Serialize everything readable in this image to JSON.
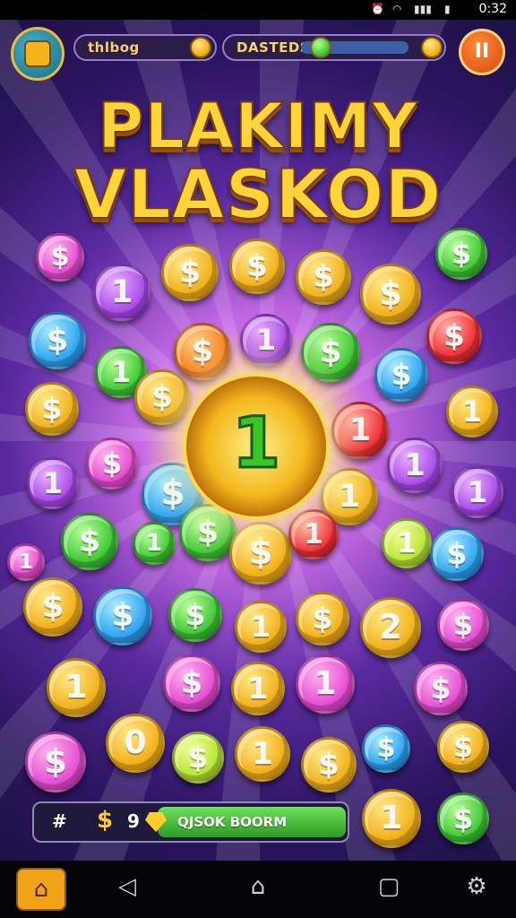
{
  "status_bar": {
    "time": "0:32"
  },
  "top_bar": {
    "left_label": "thlbog",
    "right_label": "DASTEDS",
    "pause_label": "II"
  },
  "title": {
    "line1": "PLAKIMY",
    "line2": "VLASKOD"
  },
  "center_coin": {
    "value": "1"
  },
  "bottom_bar": {
    "hash": "#",
    "currency_symbol": "$",
    "amount": "9",
    "button_label": "QJSOK BOORM"
  },
  "coin_glyphs": [
    "$",
    "1",
    "2"
  ],
  "colors": {
    "gold": "#f2b21e",
    "pink": "#e651d2",
    "purple": "#a94ee8",
    "blue": "#33a6f0",
    "green": "#45c93a",
    "red": "#f0343a",
    "orange": "#f5801e",
    "accent_button": "#2e9b23"
  },
  "coins": [
    {
      "color": "pink",
      "glyph": "$"
    },
    {
      "color": "purple",
      "glyph": "1"
    },
    {
      "color": "gold",
      "glyph": "$"
    },
    {
      "color": "gold",
      "glyph": "$"
    },
    {
      "color": "gold",
      "glyph": "$"
    },
    {
      "color": "gold",
      "glyph": "$"
    },
    {
      "color": "green",
      "glyph": "$"
    },
    {
      "color": "blue",
      "glyph": "$"
    },
    {
      "color": "orange",
      "glyph": "$"
    },
    {
      "color": "purple",
      "glyph": "1"
    },
    {
      "color": "green",
      "glyph": "$"
    },
    {
      "color": "blue",
      "glyph": "$"
    },
    {
      "color": "red",
      "glyph": "$"
    },
    {
      "color": "green",
      "glyph": "1"
    },
    {
      "color": "gold",
      "glyph": "$"
    },
    {
      "color": "gold",
      "glyph": "$"
    },
    {
      "color": "red",
      "glyph": "1"
    },
    {
      "color": "gold",
      "glyph": "1"
    },
    {
      "color": "purple",
      "glyph": "1"
    },
    {
      "color": "pink",
      "glyph": "$"
    },
    {
      "color": "purple",
      "glyph": "1"
    },
    {
      "color": "purple",
      "glyph": "1"
    },
    {
      "color": "blue",
      "glyph": "$"
    },
    {
      "color": "gold",
      "glyph": "1"
    },
    {
      "color": "green",
      "glyph": "$"
    },
    {
      "color": "gold",
      "glyph": "$"
    },
    {
      "color": "green",
      "glyph": "1"
    },
    {
      "color": "red",
      "glyph": "1"
    },
    {
      "color": "green",
      "glyph": "$"
    },
    {
      "color": "pink",
      "glyph": "1"
    },
    {
      "color": "lime",
      "glyph": "1"
    },
    {
      "color": "blue",
      "glyph": "$"
    },
    {
      "color": "gold",
      "glyph": "$"
    },
    {
      "color": "blue",
      "glyph": "$"
    },
    {
      "color": "green",
      "glyph": "$"
    },
    {
      "color": "gold",
      "glyph": "1"
    },
    {
      "color": "gold",
      "glyph": "$"
    },
    {
      "color": "gold",
      "glyph": "2"
    },
    {
      "color": "pink",
      "glyph": "$"
    },
    {
      "color": "gold",
      "glyph": "1"
    },
    {
      "color": "pink",
      "glyph": "$"
    },
    {
      "color": "gold",
      "glyph": "1"
    },
    {
      "color": "pink",
      "glyph": "1"
    },
    {
      "color": "pink",
      "glyph": "$"
    },
    {
      "color": "pink",
      "glyph": "$"
    },
    {
      "color": "gold",
      "glyph": "0"
    },
    {
      "color": "lime",
      "glyph": "$"
    },
    {
      "color": "gold",
      "glyph": "1"
    },
    {
      "color": "gold",
      "glyph": "$"
    },
    {
      "color": "blue",
      "glyph": "$"
    },
    {
      "color": "gold",
      "glyph": "$"
    },
    {
      "color": "gold",
      "glyph": "1"
    },
    {
      "color": "green",
      "glyph": "$"
    }
  ]
}
